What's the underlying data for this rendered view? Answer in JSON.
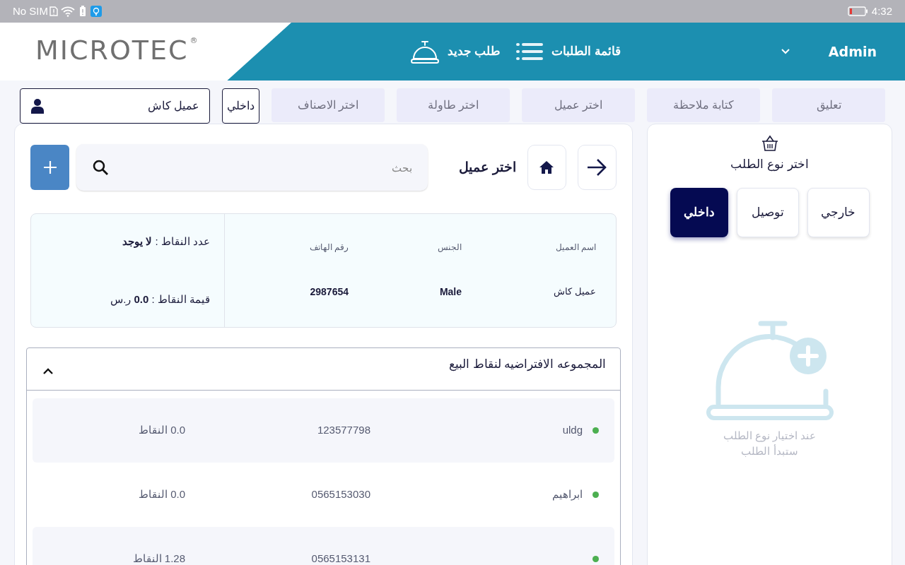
{
  "status_bar": {
    "carrier": "No SIM",
    "time": "4:32"
  },
  "header": {
    "logo": "MICROTEC",
    "logo_mark": "®",
    "nav": [
      {
        "label": "قائمة الطلبات",
        "kind": "list"
      },
      {
        "label": "طلب جديد",
        "kind": "bell"
      }
    ],
    "user": "Admin"
  },
  "actions": [
    {
      "label": "تعليق",
      "kind": "tab"
    },
    {
      "label": "كتابة ملاحظة",
      "kind": "tab"
    },
    {
      "label": "اختر عميل",
      "kind": "tab"
    },
    {
      "label": "اختر طاولة",
      "kind": "tab"
    },
    {
      "label": "اختر الاصناف",
      "kind": "tab"
    },
    {
      "label": "داخلي",
      "kind": "outlined"
    }
  ],
  "customer_field": {
    "value": "عميل كاش"
  },
  "order_panel": {
    "title": "اختر نوع الطلب",
    "types": [
      {
        "label": "خارجي",
        "selected": false
      },
      {
        "label": "توصيل",
        "selected": false
      },
      {
        "label": "داخلي",
        "selected": true
      }
    ],
    "hint": [
      "عند اختيار نوع الطلب",
      "ستبدأ الطلب"
    ]
  },
  "customer_panel": {
    "title": "اختر عميل",
    "search": {
      "placeholder": "بحث"
    },
    "info": {
      "columns": [
        {
          "heading": "اسم العميل",
          "value": "عميل كاش"
        },
        {
          "heading": "الجنس",
          "value": "Male"
        },
        {
          "heading": "رقم الهاتف",
          "value": "2987654"
        }
      ],
      "points_count": "عدد النقاط : **لا يوجد**",
      "points_value": "قيمة النقاط : **0.0** ر.س"
    },
    "group": {
      "title": "المجموعه الافتراضيه لنقاط البيع",
      "expanded": true,
      "rows": [
        {
          "name": "uldg",
          "phone": "123577798",
          "points": "0.0 النقاط",
          "color": "#4caf50"
        },
        {
          "name": "ابراهيم",
          "phone": "0565153030",
          "points": "0.0 النقاط",
          "color": "#4caf50"
        },
        {
          "phone": "0565153131",
          "points": "1.28 النقاط",
          "color": "#4caf50"
        }
      ]
    }
  }
}
